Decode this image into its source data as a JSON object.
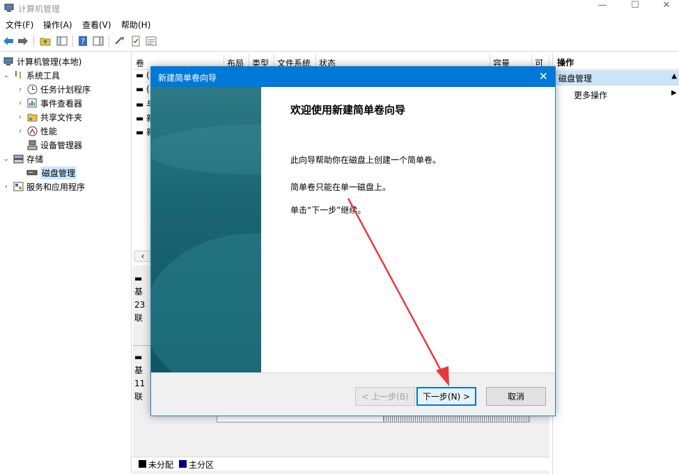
{
  "window": {
    "title": "计算机管理"
  },
  "menu": [
    "文件(F)",
    "操作(A)",
    "查看(V)",
    "帮助(H)"
  ],
  "tree": {
    "root": "计算机管理(本地)",
    "items": [
      {
        "label": "系统工具",
        "level": 1,
        "expanded": true
      },
      {
        "label": "任务计划程序",
        "level": 2
      },
      {
        "label": "事件查看器",
        "level": 2
      },
      {
        "label": "共享文件夹",
        "level": 2
      },
      {
        "label": "性能",
        "level": 2
      },
      {
        "label": "设备管理器",
        "level": 2
      },
      {
        "label": "存储",
        "level": 1,
        "expanded": true
      },
      {
        "label": "磁盘管理",
        "level": 2,
        "selected": true
      },
      {
        "label": "服务和应用程序",
        "level": 1
      }
    ]
  },
  "volume_table": {
    "columns": [
      "卷",
      "布局",
      "类型",
      "文件系统",
      "状态",
      "容量",
      "可"
    ],
    "rows": [
      "(",
      "(",
      "与",
      "新",
      "新"
    ]
  },
  "disk_panel": {
    "disk0": [
      "基",
      "23",
      "联"
    ],
    "disk1": [
      "基",
      "11",
      "联"
    ]
  },
  "legend": [
    "未分配",
    "主分区"
  ],
  "actions": {
    "header": "操作",
    "group": "磁盘管理",
    "more": "更多操作"
  },
  "dialog": {
    "title": "新建简单卷向导",
    "heading": "欢迎使用新建简单卷向导",
    "para1": "此向导帮助你在磁盘上创建一个简单卷。",
    "para2": "简单卷只能在单一磁盘上。",
    "para3": "单击“下一步”继续。",
    "back_label": "< 上一步(B)",
    "next_label": "下一步(N) >",
    "cancel_label": "取消"
  },
  "colors": {
    "accent": "#0078d7",
    "arrow": "#e8383d",
    "legend_unallocated": "#000000",
    "legend_primary": "#00007f"
  }
}
